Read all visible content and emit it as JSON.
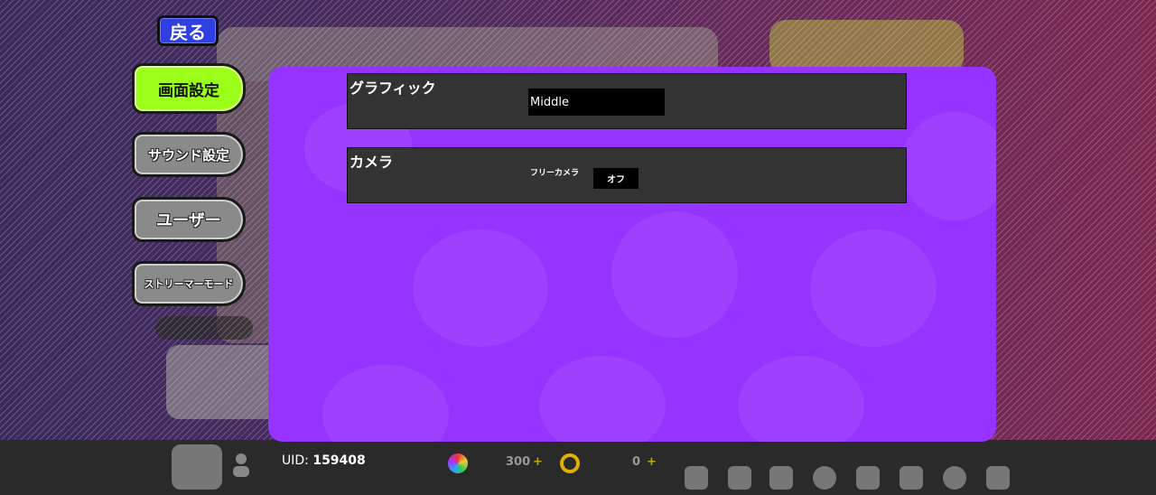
{
  "header": {
    "back_label": "戻る"
  },
  "sidebar": {
    "tabs": [
      {
        "label": "画面設定",
        "active": true
      },
      {
        "label": "サウンド設定",
        "active": false
      },
      {
        "label": "ユーザー",
        "active": false
      },
      {
        "label": "ストリーマーモード",
        "active": false
      }
    ]
  },
  "settings": {
    "graphics": {
      "title": "グラフィック",
      "value": "Middle"
    },
    "camera": {
      "title": "カメラ",
      "option_label": "フリーカメラ",
      "toggle_value": "オフ"
    }
  },
  "footer": {
    "uid_label": "UID:",
    "uid_value": "159408",
    "currency_1": "300",
    "currency_2": "0",
    "plus": "+"
  },
  "colors": {
    "panel": "#9633ff",
    "active_tab": "#9bff1a",
    "back_button": "#2f3fe0",
    "row_background": "#333333"
  },
  "icons": {
    "back": "back-button",
    "nav": [
      "person-icon",
      "megaphone-icon",
      "school-icon",
      "question-icon",
      "card-icon",
      "mail-icon",
      "gear-icon",
      "exit-icon"
    ]
  }
}
